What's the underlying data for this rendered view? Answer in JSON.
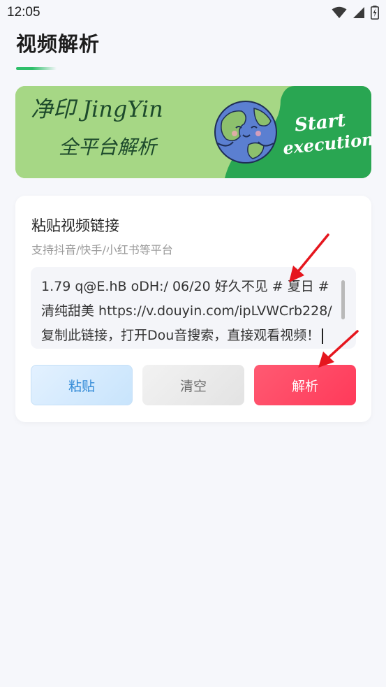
{
  "status_bar": {
    "time": "12:05",
    "icons": [
      "wifi-icon",
      "cell-signal-icon",
      "battery-charging-icon"
    ]
  },
  "header": {
    "title": "视频解析"
  },
  "banner": {
    "line1": "净印 JingYin",
    "line2": "全平台解析",
    "start_text": "Start",
    "execution_text": "execution",
    "colors": {
      "light_green": "#a9d88b",
      "dark_green": "#29a652"
    }
  },
  "card": {
    "title": "粘贴视频链接",
    "subtitle": "支持抖音/快手/小红书等平台",
    "input_value": "1.79 q@E.hB oDH:/ 06/20 好久不见 # 夏日 # 清纯甜美  https://v.douyin.com/ipLVWCrb228/ 复制此链接，打开Dou音搜索，直接观看视频！",
    "buttons": {
      "paste": "粘贴",
      "clear": "清空",
      "parse": "解析"
    }
  },
  "colors": {
    "accent_green": "#2fbf6a",
    "parse_red": "#ff4562",
    "paste_blue": "#2e88d6",
    "annotation_red": "#e5161e"
  }
}
